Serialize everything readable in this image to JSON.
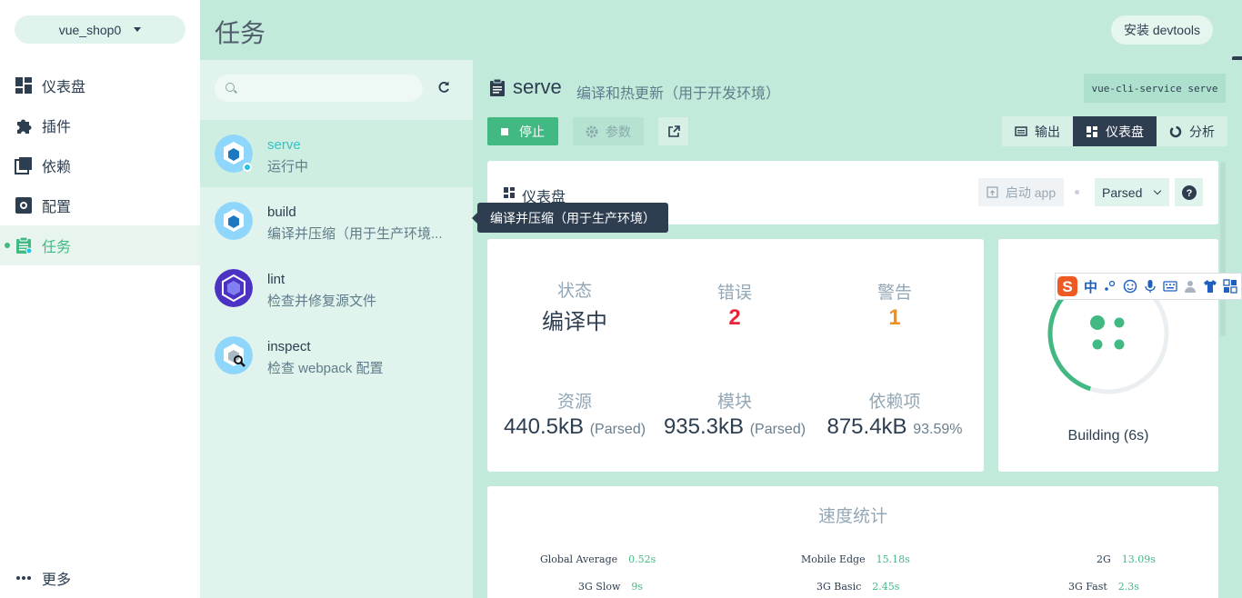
{
  "nav": {
    "project": "vue_shop0",
    "items": [
      {
        "label": "仪表盘",
        "icon": "dashboard-icon"
      },
      {
        "label": "插件",
        "icon": "puzzle-icon"
      },
      {
        "label": "依赖",
        "icon": "library-icon"
      },
      {
        "label": "配置",
        "icon": "settings-icon"
      },
      {
        "label": "任务",
        "icon": "assignment-icon",
        "active": true
      }
    ],
    "more": "更多"
  },
  "header": {
    "title": "任务",
    "devtools": "安装 devtools"
  },
  "tasks": [
    {
      "name": "serve",
      "desc": "运行中",
      "active": true
    },
    {
      "name": "build",
      "desc": "编译并压缩（用于生产环境..."
    },
    {
      "name": "lint",
      "desc": "检查并修复源文件"
    },
    {
      "name": "inspect",
      "desc": "检查 webpack 配置"
    }
  ],
  "tooltip": "编译并压缩（用于生产环境）",
  "main": {
    "title": "serve",
    "subtitle": "编译和热更新（用于开发环境）",
    "command": "vue-cli-service serve",
    "stop": "停止",
    "params": "参数",
    "views": [
      "输出",
      "仪表盘",
      "分析"
    ],
    "active_view": "仪表盘",
    "dashboard": {
      "title": "仪表盘",
      "launch": "启动 app",
      "mode": "Parsed"
    },
    "stats": {
      "status_label": "状态",
      "status": "编译中",
      "errors_label": "错误",
      "errors": "2",
      "warnings_label": "警告",
      "warnings": "1",
      "assets_label": "资源",
      "assets": "440.5kB",
      "assets_note": "(Parsed)",
      "modules_label": "模块",
      "modules": "935.3kB",
      "modules_note": "(Parsed)",
      "deps_label": "依赖项",
      "deps": "875.4kB",
      "deps_note": "93.59%"
    },
    "build_status": "Building (6s)",
    "build_progress": 0.4,
    "speed": {
      "title": "速度统计",
      "items": [
        {
          "label": "Global Average",
          "value": "0.52s"
        },
        {
          "label": "Mobile Edge",
          "value": "15.18s"
        },
        {
          "label": "2G",
          "value": "13.09s"
        },
        {
          "label": "3G Slow",
          "value": "9s"
        },
        {
          "label": "3G Basic",
          "value": "2.45s"
        },
        {
          "label": "3G Fast",
          "value": "2.3s"
        }
      ]
    }
  },
  "ime": {
    "label": "中"
  },
  "colors": {
    "accent": "#42b983",
    "header": "#c2eadb",
    "dark": "#2e3e50",
    "error": "#e8253b",
    "warning": "#f08f1b"
  }
}
